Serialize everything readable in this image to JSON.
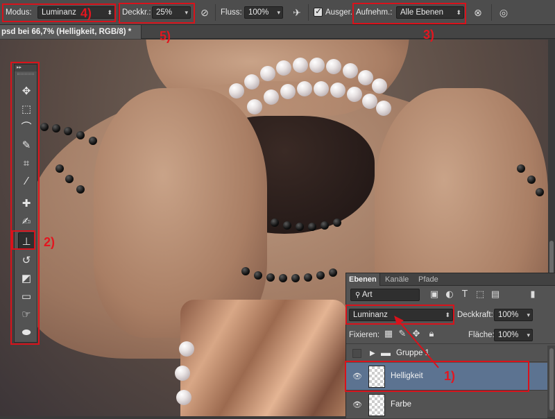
{
  "options_bar": {
    "mode_label": "Modus:",
    "mode_value": "Luminanz",
    "opacity_label": "Deckkr.:",
    "opacity_value": "25%",
    "flow_label": "Fluss:",
    "flow_value": "100%",
    "aligned_label": "Ausger.",
    "aligned_checked": true,
    "sample_label": "Aufnehm.:",
    "sample_value": "Alle Ebenen",
    "icons": [
      "clone-brush-preset-icon",
      "airbrush-pressure-icon",
      "airbrush-icon",
      "ignore-adjustment-layers-icon",
      "pressure-size-icon"
    ]
  },
  "document": {
    "tab_title": "psd bei 66,7% (Helligkeit, RGB/8) *"
  },
  "toolbox": {
    "header_glyph": "▸▸",
    "tools": [
      {
        "name": "move-tool-icon",
        "glyph": "✥"
      },
      {
        "name": "marquee-tool-icon",
        "glyph": "⬚"
      },
      {
        "name": "lasso-tool-icon",
        "glyph": "⌒"
      },
      {
        "name": "quick-selection-tool-icon",
        "glyph": "✎"
      },
      {
        "name": "crop-tool-icon",
        "glyph": "⌗"
      },
      {
        "name": "eyedropper-tool-icon",
        "glyph": "⁄"
      },
      {
        "name": "healing-brush-tool-icon",
        "glyph": "✚"
      },
      {
        "name": "brush-tool-icon",
        "glyph": "✍"
      },
      {
        "name": "clone-stamp-tool-icon",
        "glyph": "⊥",
        "active": true
      },
      {
        "name": "history-brush-tool-icon",
        "glyph": "↺"
      },
      {
        "name": "eraser-tool-icon",
        "glyph": "◩"
      },
      {
        "name": "gradient-tool-icon",
        "glyph": "▭"
      },
      {
        "name": "smudge-tool-icon",
        "glyph": "☞"
      },
      {
        "name": "dodge-tool-icon",
        "glyph": "⬬"
      }
    ]
  },
  "annotations": {
    "n1": "1)",
    "n2": "2)",
    "n3": "3)",
    "n4": "4)",
    "n5": "5)"
  },
  "layers_panel": {
    "tabs": [
      "Ebenen",
      "Kanäle",
      "Pfade"
    ],
    "active_tab": "Ebenen",
    "filter_value": "Art",
    "blend_mode": "Luminanz",
    "opacity_label": "Deckkraft:",
    "opacity_value": "100%",
    "lock_label": "Fixieren:",
    "fill_label": "Fläche:",
    "fill_value": "100%",
    "layers": [
      {
        "name": "Gruppe 1",
        "type": "group",
        "visible": false,
        "selected": false
      },
      {
        "name": "Helligkeit",
        "type": "layer",
        "visible": true,
        "selected": true
      },
      {
        "name": "Farbe",
        "type": "layer",
        "visible": true,
        "selected": false
      }
    ]
  },
  "colors": {
    "annotation_red": "#d9121b",
    "selected_layer": "#5c7391",
    "panel_bg": "#535353"
  }
}
